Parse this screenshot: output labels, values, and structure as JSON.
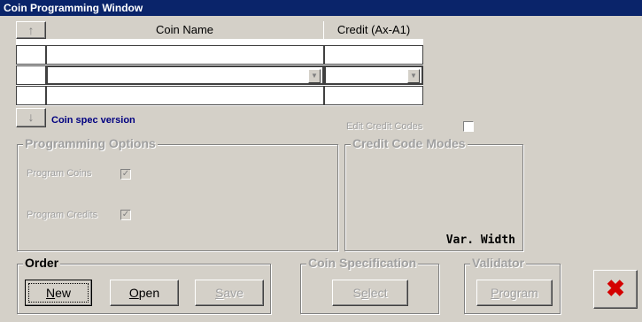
{
  "window": {
    "title": "Coin Programming Window"
  },
  "grid": {
    "headers": {
      "coin_name": "Coin Name",
      "credit": "Credit (Ax-A1)"
    },
    "up_arrow": "↑",
    "down_arrow": "↓",
    "dropdown_arrow": "▼"
  },
  "coin_spec_version_label": "Coin spec version",
  "edit_credit_codes_label": "Edit Credit Codes",
  "programming_options": {
    "title": "Programming Options",
    "program_coins": "Program Coins",
    "program_credits": "Program Credits",
    "check_glyph": "✓"
  },
  "credit_code_modes": {
    "title": "Credit Code Modes",
    "value": "Var. Width"
  },
  "order": {
    "title": "Order",
    "new_prefix": "",
    "new_mnemonic": "N",
    "new_rest": "ew",
    "open_prefix": "",
    "open_mnemonic": "O",
    "open_rest": "pen",
    "save_prefix": "",
    "save_mnemonic": "S",
    "save_rest": "ave"
  },
  "coin_specification": {
    "title": "Coin Specification",
    "select_prefix": "S",
    "select_mnemonic": "e",
    "select_rest": "lect"
  },
  "validator": {
    "title": "Validator",
    "program_prefix": "",
    "program_mnemonic": "P",
    "program_rest": "rogram"
  },
  "close_glyph": "✖",
  "colors": {
    "title_bar": "#0a246a",
    "window_bg": "#d4d0c8",
    "close_x": "#d40000",
    "spec_label": "#000080"
  }
}
